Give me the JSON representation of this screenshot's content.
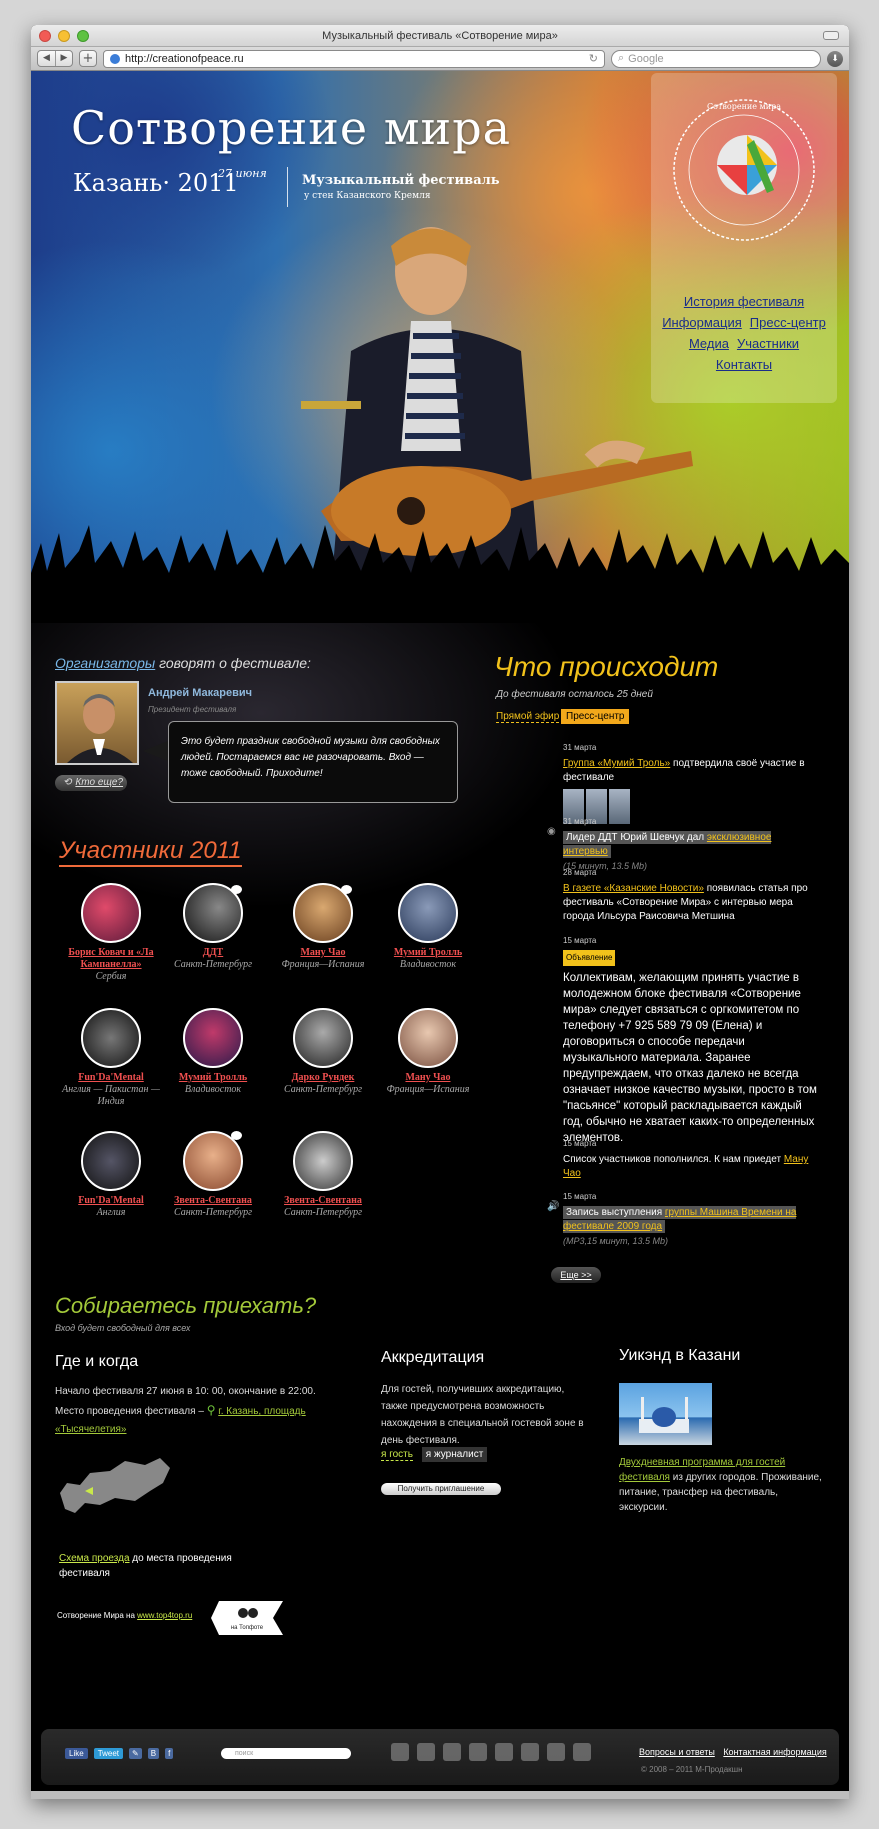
{
  "browser": {
    "title": "Музыкальный фестиваль «Сотворение мира»",
    "url": "http://creationofpeace.ru",
    "search_placeholder": "Google"
  },
  "hero": {
    "title": "Сотворение мира",
    "city_year": "Казань· 2011",
    "date": "27 июня",
    "festival": "Музыкальный фестиваль",
    "festival_sub": "у стен Казанского Кремля",
    "nav": [
      "История фестиваля",
      "Информация",
      "Пресс-центр",
      "Медиа",
      "Участники",
      "Контакты"
    ]
  },
  "organizers": {
    "heading_link": "Организаторы",
    "heading_rest": " говорят о фестивале:",
    "name": "Андрей Макаревич",
    "role": "Президент фестиваля",
    "quote": "Это будет праздник свободной музыки для свободных людей. Постараемся вас не разочаровать. Вход — тоже свободный. Приходите!",
    "more": "Кто еще?"
  },
  "participants": {
    "title": "Участники 2011",
    "artists": [
      {
        "name": "Борис Ковач и «Ла Кампанелла»",
        "city": "Сербия"
      },
      {
        "name": "ДДТ",
        "city": "Санкт-Петербург"
      },
      {
        "name": "Ману Чао",
        "city": "Франция—Испания"
      },
      {
        "name": "Мумий Тролль",
        "city": "Владивосток"
      },
      {
        "name": "Fun'Da'Mental",
        "city": "Англия — Пакистан — Индия"
      },
      {
        "name": "Мумий Тролль",
        "city": "Владивосток"
      },
      {
        "name": "Дарко Рундек",
        "city": "Санкт-Петербург"
      },
      {
        "name": "Ману Чао",
        "city": "Франция—Испания"
      },
      {
        "name": "Fun'Da'Mental",
        "city": "Англия"
      },
      {
        "name": "Звента-Свентана",
        "city": "Санкт-Петербург"
      },
      {
        "name": "Звента-Свентана",
        "city": "Санкт-Петербург"
      }
    ]
  },
  "whats_on": {
    "title": "Что происходит",
    "countdown": "До фестиваля осталось 25 дней",
    "tab_live": "Прямой эфир",
    "tab_press": "Пресс-центр",
    "news": [
      {
        "date": "31 марта",
        "link": "Группа «Мумий Троль»",
        "text": " подтвердила своё участие в фестивале"
      },
      {
        "date": "31 марта",
        "text": "Лидер ДДТ Юрий Шевчук дал ",
        "link": "эксклюзивное интервью",
        "meta": "(15 минут, 13.5 Mb)"
      },
      {
        "date": "28 марта",
        "link": "В газете «Казанские Новости»",
        "text": " появилась статья про фестиваль «Сотворение Мира» с интервью мера города Ильсура Раисовича Метшина"
      },
      {
        "date": "15 марта",
        "tag": "Объявление",
        "text": "Коллективам, желающим принять участие в молодежном блоке фестиваля «Сотворение мира» следует связаться с оргкомитетом по телефону +7 925 589 79 09 (Елена) и договориться о способе передачи музыкального материала. Заранее предупреждаем, что отказ далеко не всегда означает низкое качество музыки, просто в том \"пасьянсе\" который раскладывается каждый год, обычно не хватает каких-то определенных элементов."
      },
      {
        "date": "15 марта",
        "text": "Список участников пополнился. К нам приедет ",
        "link": "Ману Чао"
      },
      {
        "date": "15 марта",
        "text": "Запись выступления ",
        "link": "группы Машина Времени на фестивале 2009 года",
        "meta": "(MP3,15 минут, 13.5 Mb)"
      }
    ],
    "more": "Еще >>"
  },
  "visit": {
    "title": "Собираетесь приехать?",
    "subtitle": "Вход будет свободный для всех",
    "where": {
      "heading": "Где и когда",
      "text": "Начало фестиваля 27 июня в 10: 00, окончание в 22:00. Место проведения фестиваля –",
      "place_link": "г. Казань, площадь «Тысячелетия»",
      "schema_link": "Схема проезда",
      "schema_rest": " до места проведения фестиваля",
      "top4_text": "Сотворение Мира на ",
      "top4_link": "www.top4top.ru",
      "badge": "на Топфоте"
    },
    "accreditation": {
      "heading": "Аккредитация",
      "text": "Для гостей, получивших аккредитацию, также предусмотрена возможность нахождения в специальной гостевой зоне в день фестиваля.",
      "guest": "я гость",
      "journalist": "я журналист",
      "invite": "Получить приглашение"
    },
    "weekend": {
      "heading": "Уикэнд в Казани",
      "link": "Двухдневная программа для гостей фестиваля",
      "text": " из других городов. Проживание, питание, трансфер на фестиваль, экскурсии."
    }
  },
  "footer": {
    "like": "Like",
    "tweet": "Tweet",
    "search_placeholder": "поиск",
    "faq": "Вопросы и ответы",
    "contact": "Контактная информация",
    "copyright": "© 2008 – 2011 М-Продакшн"
  }
}
